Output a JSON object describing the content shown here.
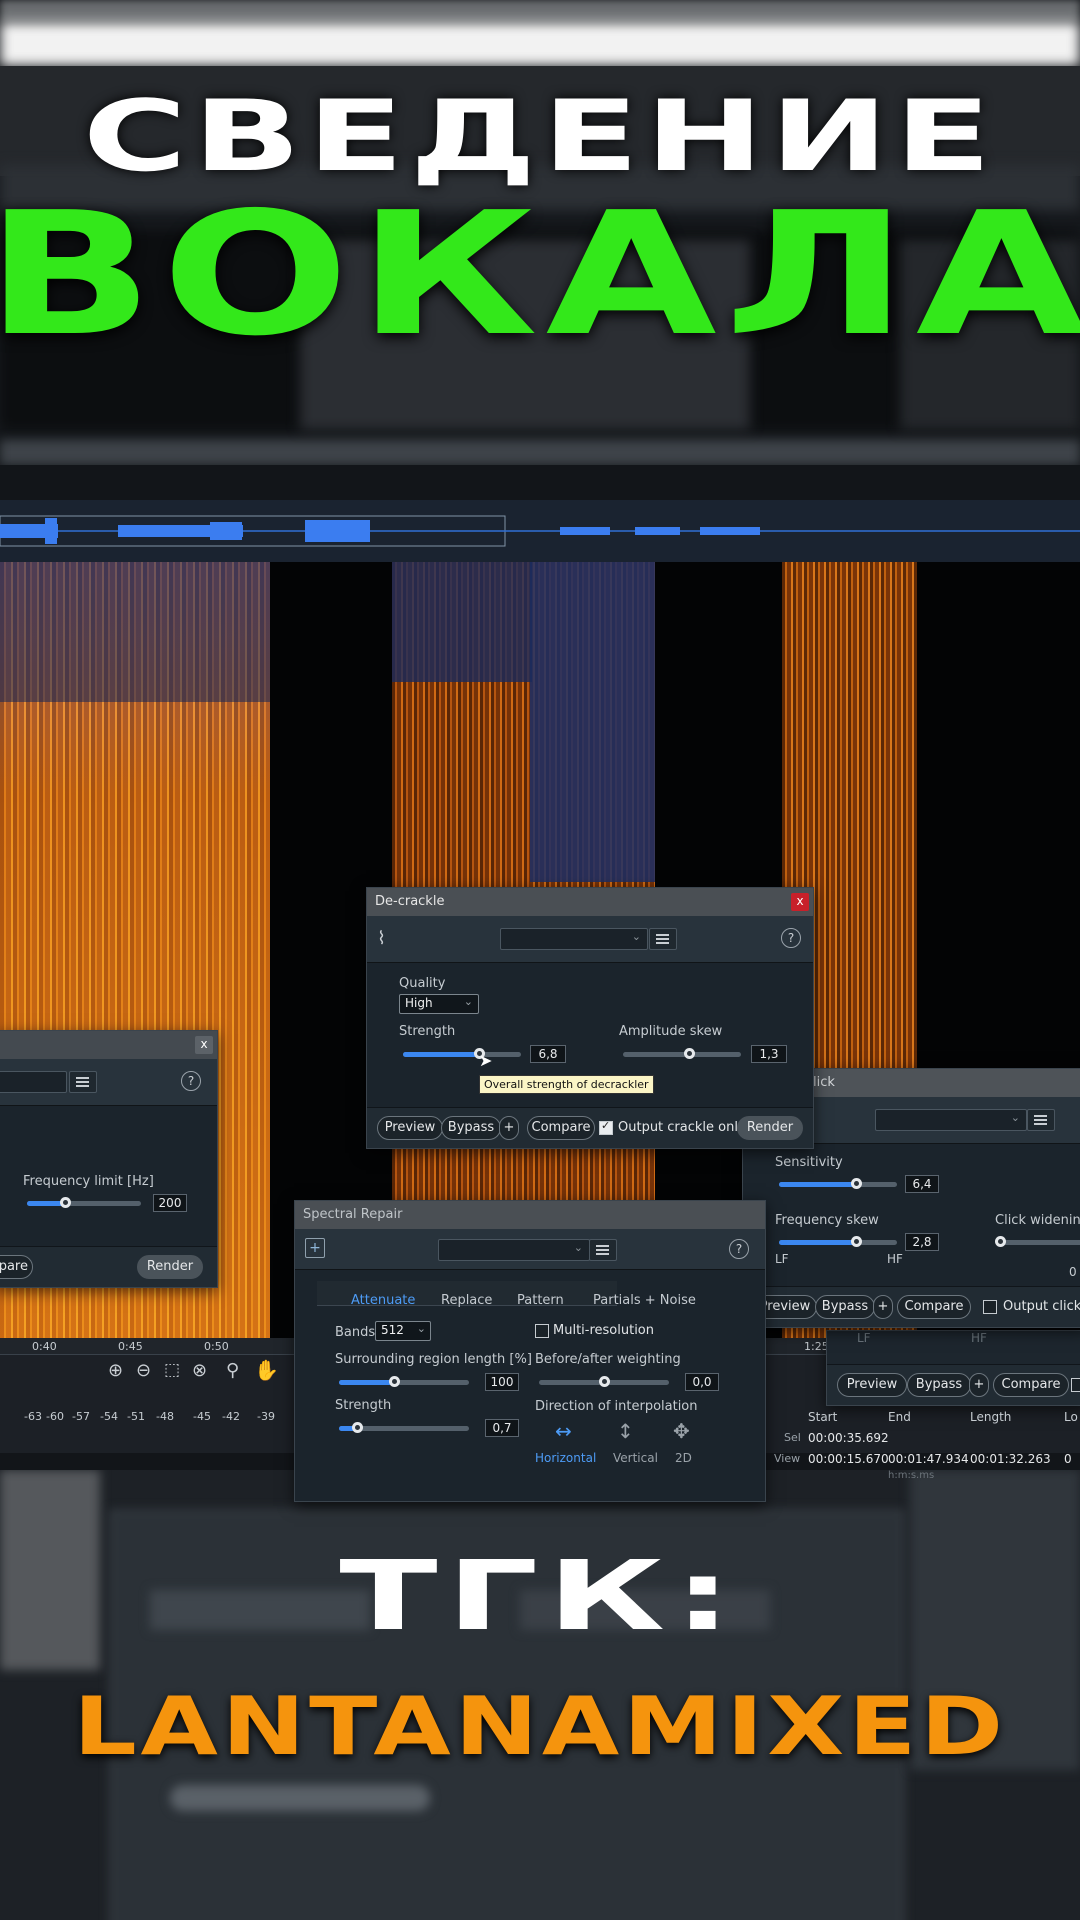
{
  "headline": {
    "line1": "СВЕДЕНИЕ",
    "line2": "ВОКАЛА"
  },
  "cta": {
    "line1": "ТГК:",
    "line2": "LANTANAMIXED"
  },
  "colors": {
    "green": "#33e81a",
    "orange": "#f5940d",
    "accent_blue": "#3b87f0",
    "close_red": "#c8202a"
  },
  "decrackle": {
    "title": "De-crackle",
    "close": "x",
    "quality_label": "Quality",
    "quality_value": "High",
    "strength_label": "Strength",
    "strength_value": "6,8",
    "strength_level": 0.64,
    "amp_skew_label": "Amplitude skew",
    "amp_skew_value": "1,3",
    "amp_skew_level": 0.56,
    "tooltip": "Overall strength of decrackler",
    "preview": "Preview",
    "bypass": "Bypass",
    "plus": "+",
    "compare": "Compare",
    "output_only": "Output crackle only",
    "render": "Render"
  },
  "left_panel": {
    "close": "x",
    "freq_limit_label": "Frequency limit [Hz]",
    "freq_limit_value": "200",
    "freq_level": 0.33,
    "compare_partial": "pare",
    "render": "Render"
  },
  "declick": {
    "title_partial": "lick",
    "sensitivity_label": "Sensitivity",
    "sensitivity_value": "6,4",
    "sensitivity_level": 0.65,
    "freq_skew_label": "Frequency skew",
    "freq_skew_value": "2,8",
    "freq_skew_level": 0.65,
    "lf": "LF",
    "hf": "HF",
    "click_widening_label": "Click widening [",
    "zero": "0",
    "preview": "Preview",
    "bypass": "Bypass",
    "plus": "+",
    "compare": "Compare",
    "output_clicks": "Output clicks o"
  },
  "back_panel": {
    "lf": "LF",
    "hf": "HF",
    "preview": "Preview",
    "bypass": "Bypass",
    "plus": "+",
    "compare": "Compare"
  },
  "spectral": {
    "title": "Spectral Repair",
    "tabs": [
      "Attenuate",
      "Replace",
      "Pattern",
      "Partials + Noise"
    ],
    "bands_label": "Bands",
    "bands_value": "512",
    "multires_label": "Multi-resolution",
    "surround_label": "Surrounding region length [%]",
    "surround_value": "100",
    "surround_level": 0.42,
    "weighting_label": "Before/after weighting",
    "weighting_value": "0,0",
    "weighting_level": 0.5,
    "strength_label": "Strength",
    "strength_value": "0,7",
    "strength_level": 0.14,
    "direction_label": "Direction of interpolation",
    "directions": [
      "Horizontal",
      "Vertical",
      "2D"
    ]
  },
  "timeline": {
    "ticks": [
      "0:40",
      "0:45",
      "0:50"
    ],
    "tick_right": "1:25",
    "db_scale": [
      "-63",
      "-60",
      "-57",
      "-54",
      "-51",
      "-48",
      "-45",
      "-42",
      "-39"
    ]
  },
  "selection": {
    "headers": [
      "Start",
      "End",
      "Length",
      "Lo"
    ],
    "sel_label": "Sel",
    "sel_start": "00:00:35.692",
    "view_label": "View",
    "view_start": "00:00:15.670",
    "view_end": "00:01:47.934",
    "view_length": "00:01:32.263",
    "view_lo": "0",
    "unit": "h:m:s.ms"
  }
}
